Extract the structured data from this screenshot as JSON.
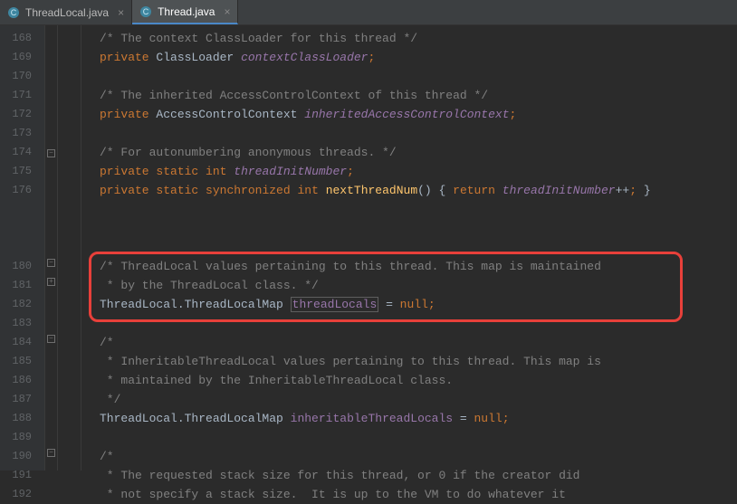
{
  "tabs": [
    {
      "label": "ThreadLocal.java"
    },
    {
      "label": "Thread.java"
    }
  ],
  "activeTab": 1,
  "startLine": 168,
  "highlight": {
    "fromLine": 180,
    "toLine": 182
  },
  "code": {
    "l168": {
      "cmt": "/* The context ClassLoader for this thread */"
    },
    "l169": {
      "kw": "private",
      "typ": "ClassLoader",
      "id": "contextClassLoader",
      "semi": ";"
    },
    "l171": {
      "cmt": "/* The inherited AccessControlContext of this thread */"
    },
    "l172": {
      "kw": "private",
      "typ": "AccessControlContext",
      "id": "inheritedAccessControlContext",
      "semi": ";"
    },
    "l174": {
      "cmt": "/* For autonumbering anonymous threads. */"
    },
    "l175": {
      "kw1": "private",
      "kw2": "static",
      "kw3": "int",
      "id": "threadInitNumber",
      "semi": ";"
    },
    "l176": {
      "kw1": "private",
      "kw2": "static",
      "kw3": "synchronized",
      "kw4": "int",
      "mth": "nextThreadNum",
      "par": "()",
      "ob": " { ",
      "ret": "return",
      "id": "threadInitNumber",
      "op": "++",
      "semi": ";",
      "cb": " }"
    },
    "l180": {
      "cmt": "/* ThreadLocal values pertaining to this thread. This map is maintained"
    },
    "l181": {
      "cmt": " * by the ThreadLocal class. */"
    },
    "l182": {
      "typ": "ThreadLocal.ThreadLocalMap ",
      "id": "threadLocals",
      "eq": " = ",
      "kw": "null",
      "semi": ";"
    },
    "l184": {
      "cmt": "/*"
    },
    "l185": {
      "cmt": " * InheritableThreadLocal values pertaining to this thread. This map is"
    },
    "l186": {
      "cmt": " * maintained by the InheritableThreadLocal class."
    },
    "l187": {
      "cmt": " */"
    },
    "l188": {
      "typ": "ThreadLocal.ThreadLocalMap",
      "id": "inheritableThreadLocals",
      "eq": " = ",
      "kw": "null",
      "semi": ";"
    },
    "l190": {
      "cmt": "/*"
    },
    "l191": {
      "cmt": " * The requested stack size for this thread, or 0 if the creator did"
    },
    "l192": {
      "cmt": " * not specify a stack size.  It is up to the VM to do whatever it"
    }
  }
}
